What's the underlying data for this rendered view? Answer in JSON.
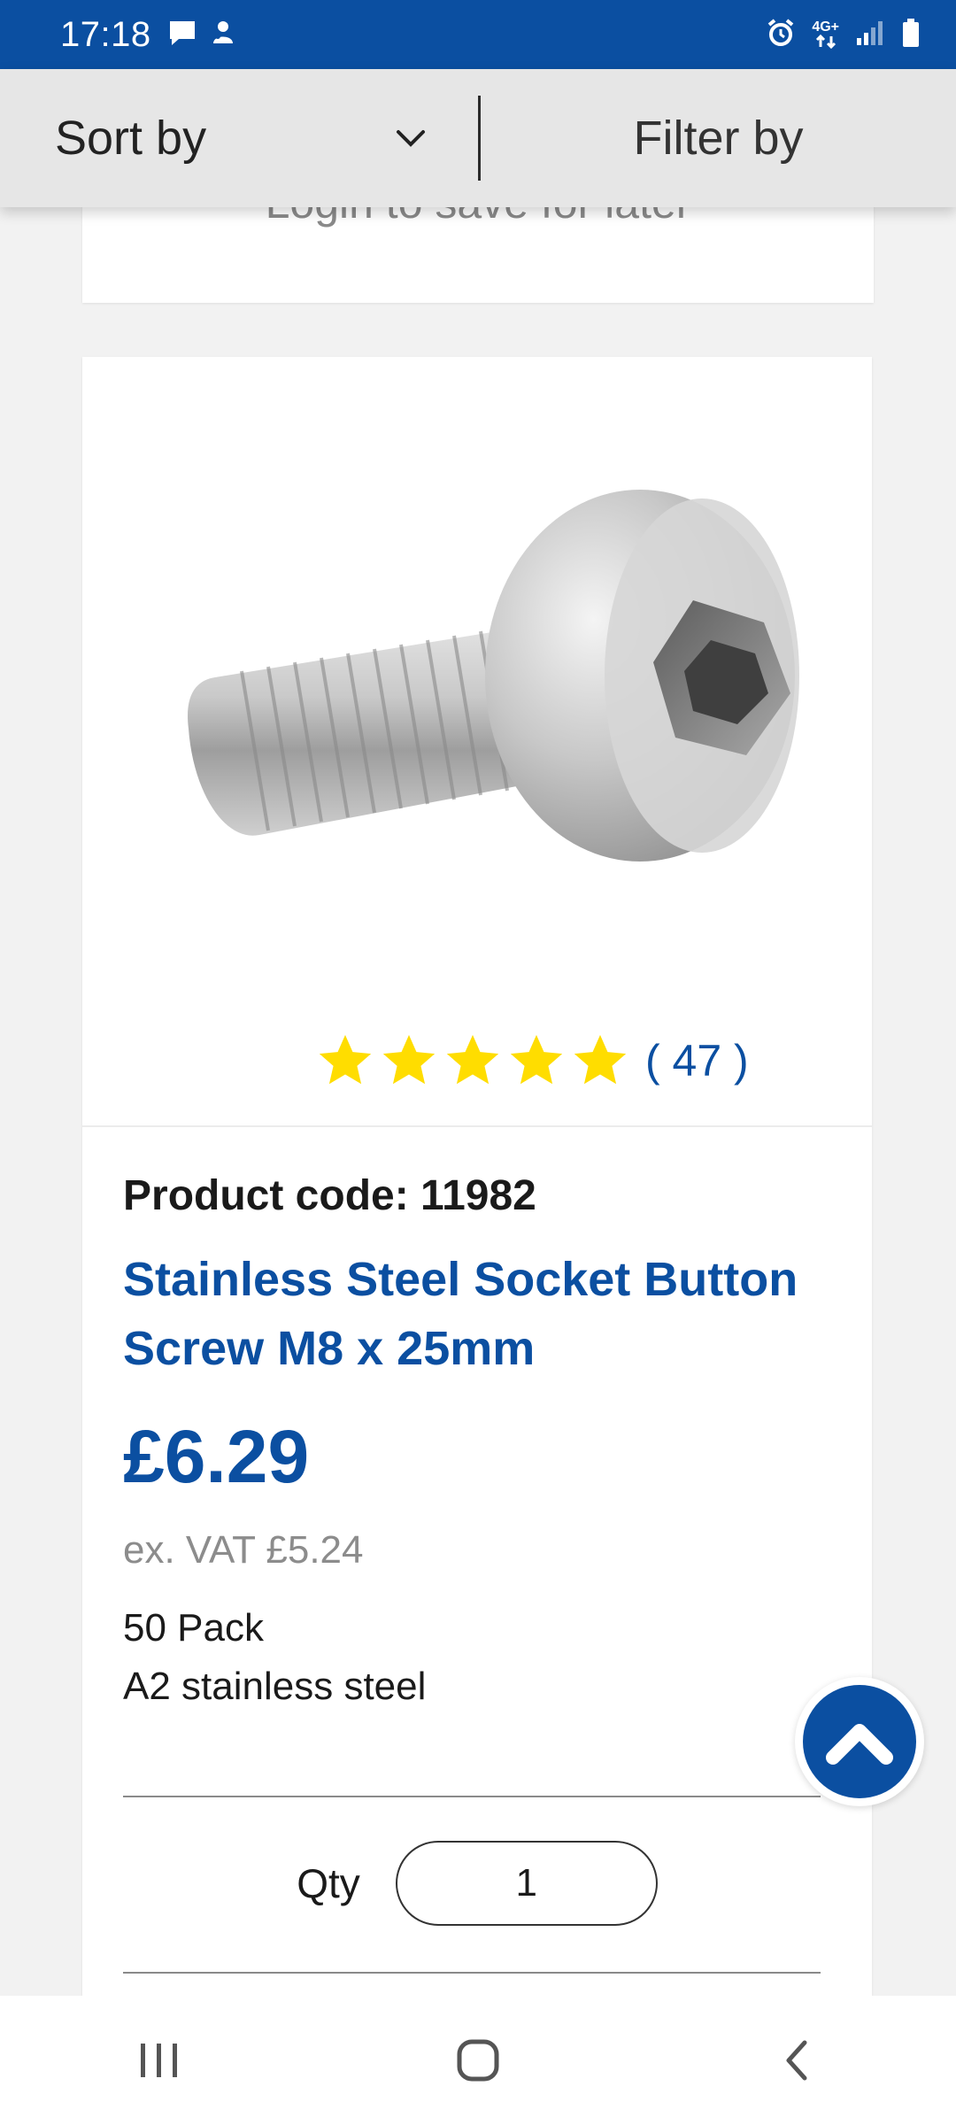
{
  "status_bar": {
    "time": "17:18",
    "network": "4G+",
    "left_icons": [
      "message-icon",
      "notification-icon"
    ],
    "right_icons": [
      "alarm-icon",
      "network-icon",
      "signal-icon",
      "battery-icon"
    ]
  },
  "sort_filter": {
    "sort_label": "Sort by",
    "filter_label": "Filter by"
  },
  "previous_card": {
    "login_text": "Login to save for later"
  },
  "product": {
    "rating": {
      "stars": 5,
      "count_text": "( 47 )"
    },
    "code_text": "Product code: 11982",
    "title": "Stainless Steel Socket Button Screw M8 x 25mm",
    "price": "£6.29",
    "ex_vat": "ex. VAT £5.24",
    "pack": "50 Pack",
    "material": "A2 stainless steel",
    "qty_label": "Qty",
    "qty_value": "1"
  },
  "colors": {
    "brand_blue": "#0b4fa1",
    "star_yellow": "#ffdd00"
  },
  "nav_bar": {
    "icons": [
      "recent-apps-icon",
      "home-icon",
      "back-icon"
    ]
  }
}
